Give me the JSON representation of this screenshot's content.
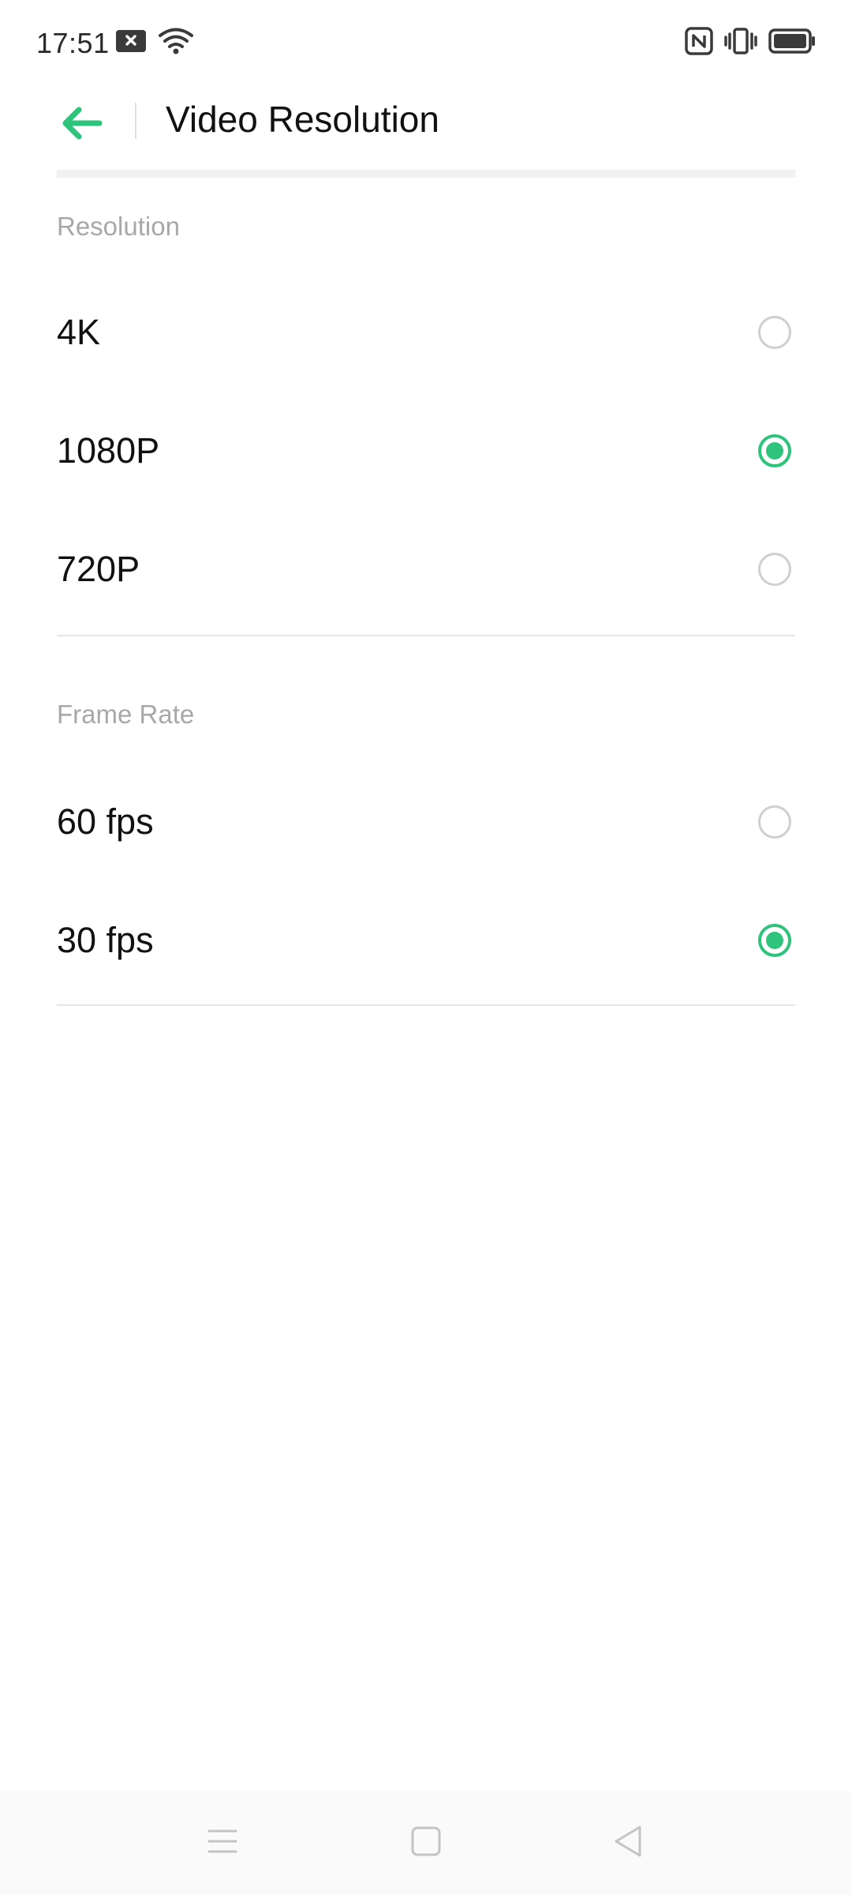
{
  "status_bar": {
    "time": "17:51",
    "icons_left": [
      "notification-close-icon",
      "wifi-icon"
    ],
    "icons_right": [
      "nfc-icon",
      "vibrate-icon",
      "battery-icon"
    ]
  },
  "header": {
    "back_icon": "arrow-left-icon",
    "title": "Video Resolution"
  },
  "resolution_section": {
    "label": "Resolution",
    "options": [
      {
        "label": "4K",
        "selected": false
      },
      {
        "label": "1080P",
        "selected": true
      },
      {
        "label": "720P",
        "selected": false
      }
    ]
  },
  "frame_rate_section": {
    "label": "Frame Rate",
    "options": [
      {
        "label": "60 fps",
        "selected": false
      },
      {
        "label": "30 fps",
        "selected": true
      }
    ]
  },
  "nav_bar": {
    "icons": [
      "menu-icon",
      "home-icon",
      "back-icon"
    ]
  },
  "colors": {
    "accent": "#2ec47b",
    "section_label": "#a8a8a8",
    "divider": "#e6e6e6"
  }
}
